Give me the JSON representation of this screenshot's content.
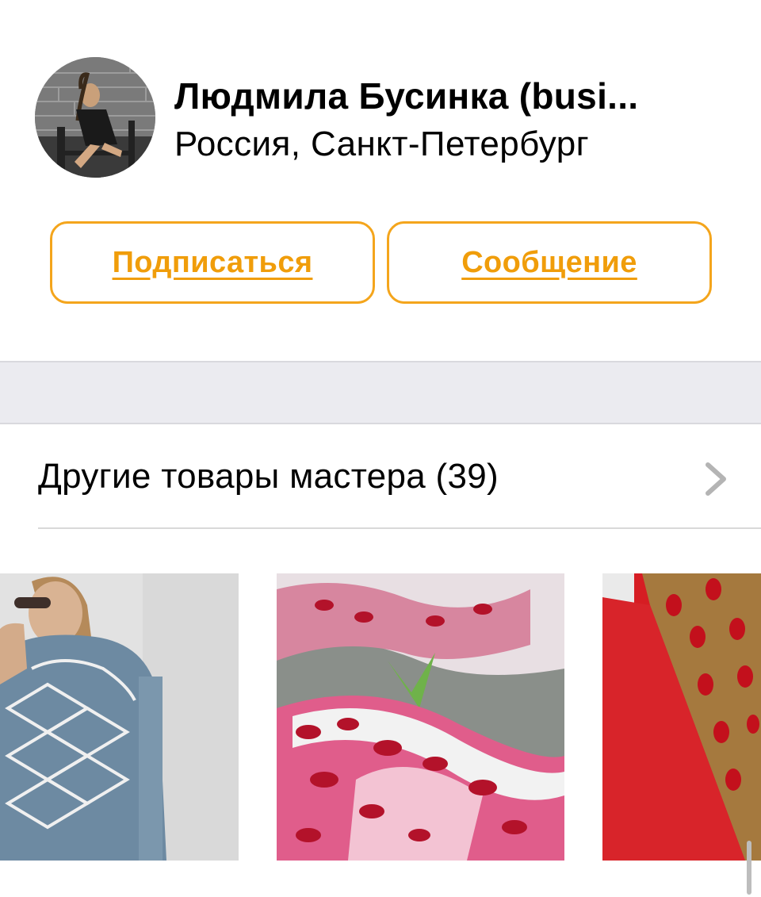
{
  "profile": {
    "name": "Людмила Бусинка (busi...",
    "location": "Россия, Санкт-Петербург",
    "avatar_icon": "avatar-photo"
  },
  "actions": {
    "subscribe_label": "Подписаться",
    "message_label": "Сообщение"
  },
  "other_products": {
    "title": "Другие товары мастера (39)",
    "chevron_icon": "chevron-right-icon",
    "items": [
      {
        "image": "embellished-denim-jacket"
      },
      {
        "image": "beaded-flower-embroidery"
      },
      {
        "image": "red-dress-jeweled-collar"
      }
    ]
  },
  "colors": {
    "accent": "#f4a51c",
    "accent_text": "#f09d0a",
    "section_gap": "#ebebf0",
    "divider": "#d9d9d9"
  }
}
